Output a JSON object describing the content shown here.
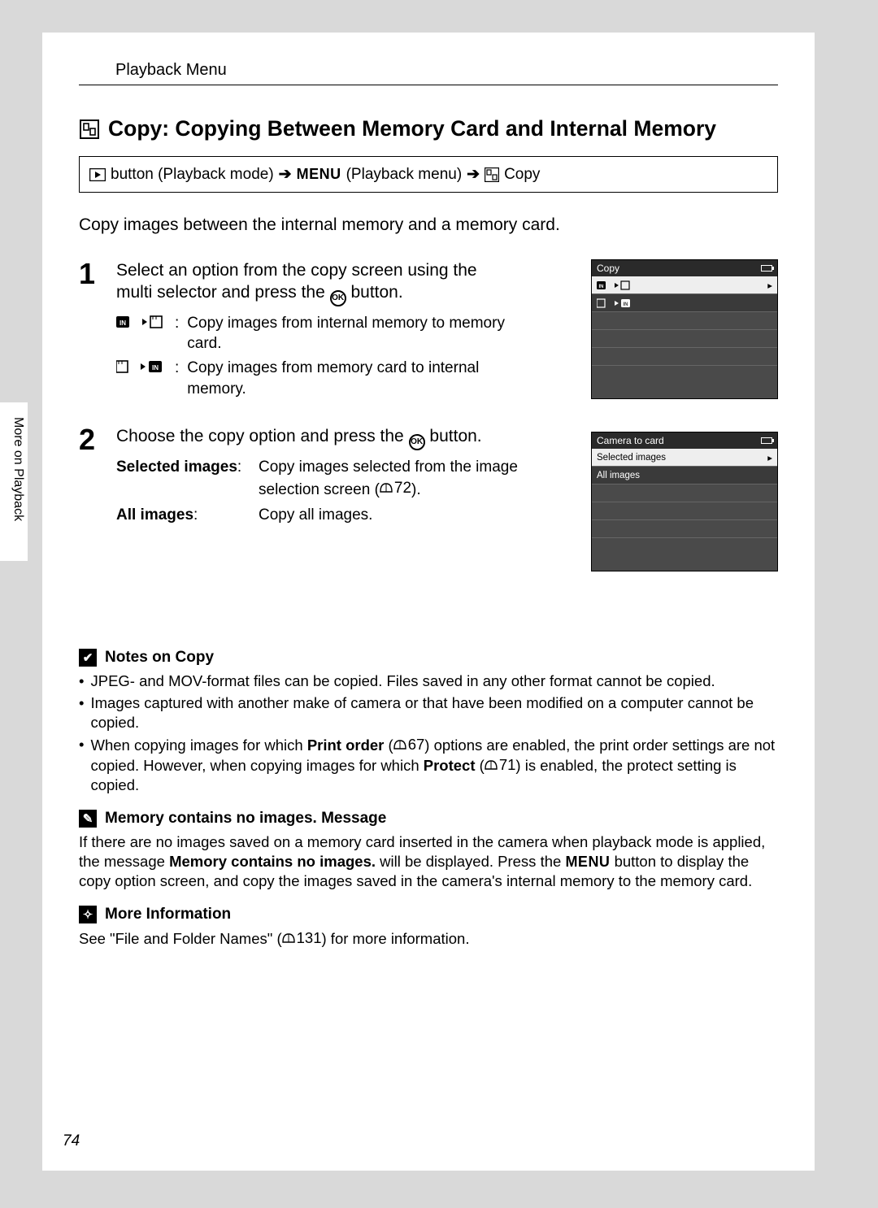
{
  "header": "Playback Menu",
  "side_label": "More on Playback",
  "page_number": "74",
  "title": "Copy: Copying Between Memory Card and Internal Memory",
  "breadcrumb": {
    "part1": "button (Playback mode)",
    "menu": "MENU",
    "part2": "(Playback menu)",
    "part3": "Copy"
  },
  "intro": "Copy images between the internal memory and a memory card.",
  "step1": {
    "num": "1",
    "lead_a": "Select an option from the copy screen using the multi selector and press the ",
    "lead_b": " button.",
    "opt1": "Copy images from internal memory to memory card.",
    "opt2": "Copy images from memory card to internal memory."
  },
  "step2": {
    "num": "2",
    "lead_a": "Choose the copy option and press the ",
    "lead_b": " button.",
    "t1": "Selected images",
    "d1a": "Copy images selected from the image selection screen (",
    "d1_page": "72",
    "d1b": ").",
    "t2": "All images",
    "d2": "Copy all images."
  },
  "screen1": {
    "title": "Copy"
  },
  "screen2": {
    "title": "Camera to card",
    "r1": "Selected images",
    "r2": "All images"
  },
  "notes": {
    "h1": "Notes on Copy",
    "b1": "JPEG- and MOV-format files can be copied. Files saved in any other format cannot be copied.",
    "b2": "Images captured with another make of camera or that have been modified on a computer cannot be copied.",
    "b3a": "When copying images for which ",
    "b3_print": "Print order",
    "b3b": " (",
    "b3_page1": "67",
    "b3c": ") options are enabled, the print order settings are not copied. However, when copying images for which ",
    "b3_protect": "Protect",
    "b3d": " (",
    "b3_page2": "71",
    "b3e": ") is enabled, the protect setting is copied.",
    "h2": "Memory contains no images. Message",
    "p2a": "If there are no images saved on a memory card inserted in the camera when playback mode is applied, the message ",
    "p2_bold": "Memory contains no images.",
    "p2b": " will be displayed. Press the ",
    "p2_menu": "MENU",
    "p2c": " button to display the copy option screen, and copy the images saved in the camera's internal memory to the memory card.",
    "h3": "More Information",
    "p3a": "See \"File and Folder Names\" (",
    "p3_page": "131",
    "p3b": ") for more information."
  }
}
